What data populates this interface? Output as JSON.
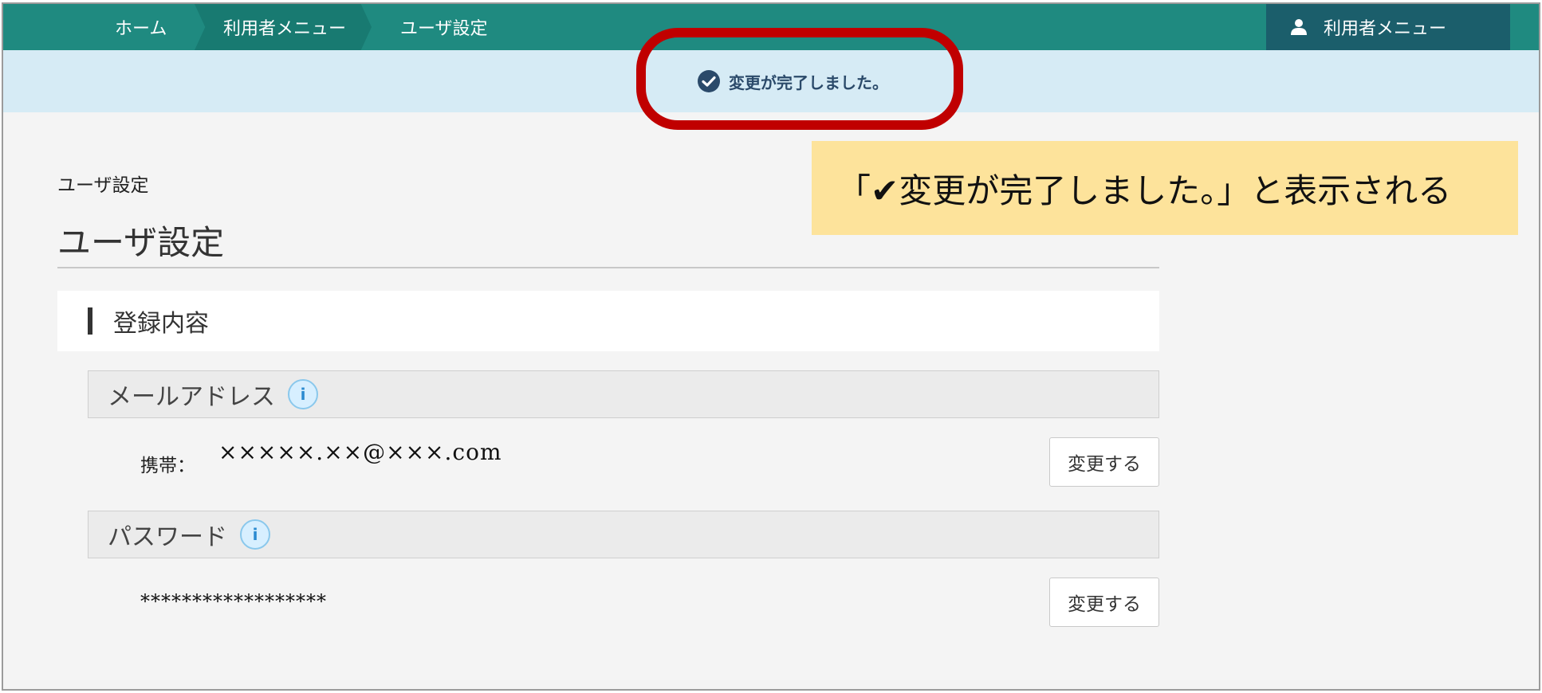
{
  "breadcrumb": {
    "home": "ホーム",
    "menu": "利用者メニュー",
    "current": "ユーザ設定"
  },
  "user_menu": {
    "label": "利用者メニュー",
    "icon": "user-icon"
  },
  "flash": {
    "message": "変更が完了しました。",
    "icon": "check-circle-icon"
  },
  "callout": {
    "text": "「✔変更が完了しました。」と表示される"
  },
  "page": {
    "small_title": "ユーザ設定",
    "title": "ユーザ設定"
  },
  "section": {
    "title": "登録内容"
  },
  "email": {
    "label": "メールアドレス",
    "prefix": "携帯：",
    "value": "×××××.××@×××.com",
    "button": "変更する"
  },
  "password": {
    "label": "パスワード",
    "value": "******************",
    "button": "変更する"
  },
  "info_icon_glyph": "i",
  "colors": {
    "navbar": "#1f8a80",
    "user_menu": "#1b5e6b",
    "flash_bg": "#d6ebf5",
    "highlight": "#c00000",
    "callout_bg": "#fde39b"
  }
}
